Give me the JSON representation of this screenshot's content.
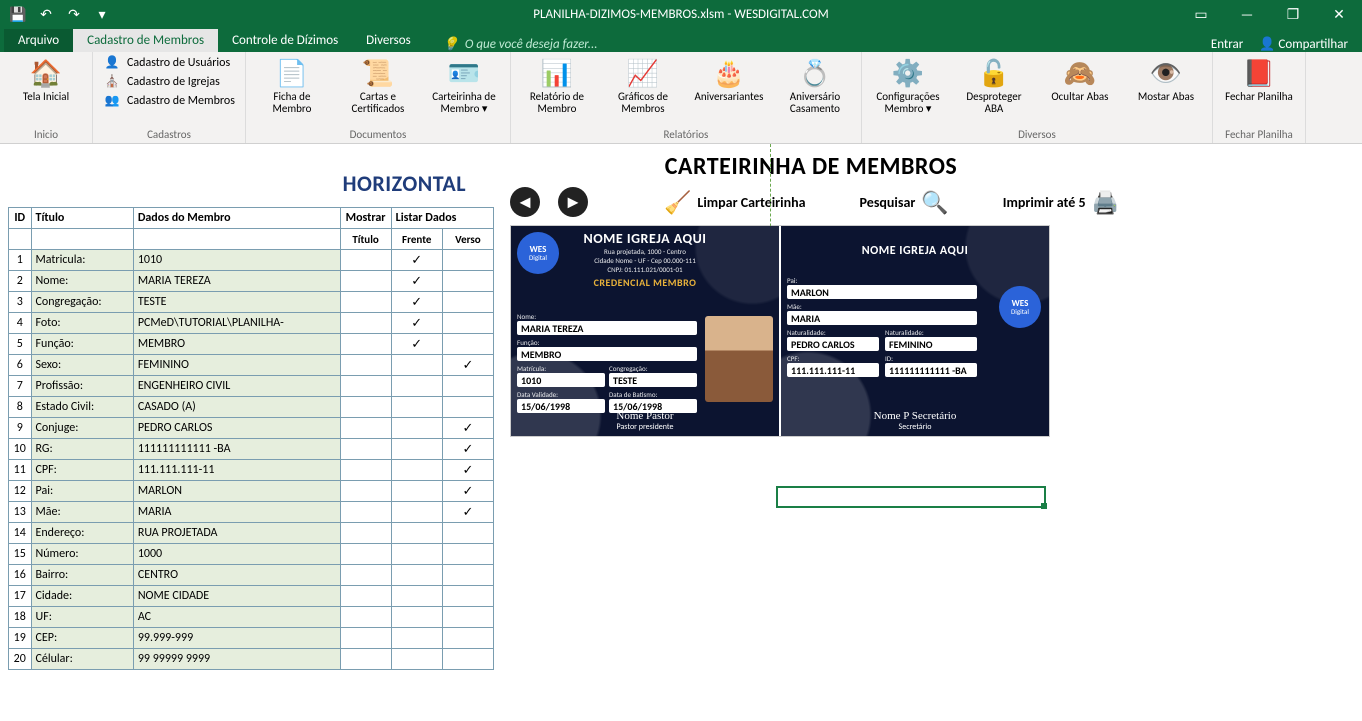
{
  "title": "PLANILHA-DIZIMOS-MEMBROS.xlsm - WESDIGITAL.COM",
  "qat": {
    "save": "💾",
    "undo": "↶",
    "redo": "↷",
    "custom": "▾"
  },
  "win": {
    "opts": "▭",
    "min": "—",
    "max": "❐",
    "close": "✕"
  },
  "tabs": {
    "file": "Arquivo",
    "t1": "Cadastro de Membros",
    "t2": "Controle de Dízimos",
    "t3": "Diversos",
    "tellme": "O que você deseja fazer...",
    "entrar": "Entrar",
    "share": "Compartilhar"
  },
  "ribbon": {
    "g_inicio": {
      "label": "Inicio",
      "b1": "Tela Inicial"
    },
    "g_cadastros": {
      "label": "Cadastros",
      "s1": "Cadastro de Usuários",
      "s2": "Cadastro de Igrejas",
      "s3": "Cadastro de Membros"
    },
    "g_docs": {
      "label": "Documentos",
      "b1": "Ficha de Membro",
      "b2": "Cartas e Certificados",
      "b3": "Carteirinha de Membro ▾"
    },
    "g_rel": {
      "label": "Relatórios",
      "b1": "Relatório de Membro",
      "b2": "Gráficos de Membros",
      "b3": "Aniversariantes",
      "b4": "Aniversário Casamento"
    },
    "g_div": {
      "label": "Diversos",
      "b1": "Configurações Membro ▾",
      "b2": "Desproteger ABA",
      "b3": "Ocultar Abas",
      "b4": "Mostar Abas"
    },
    "g_fechar": {
      "label": "Fechar Planilha",
      "b1": "Fechar Planilha"
    }
  },
  "page": {
    "maintitle": "CARTEIRINHA DE MEMBROS",
    "horiz": "HORIZONTAL",
    "limpar": "Limpar Carteirinha",
    "pesquisar": "Pesquisar",
    "imprimir": "Imprimir até 5"
  },
  "th": {
    "id": "ID",
    "titulo": "Título",
    "dados": "Dados do Membro",
    "mostrar": "Mostrar",
    "listar": "Listar Dados",
    "sub_titulo": "Título",
    "sub_frente": "Frente",
    "sub_verso": "Verso"
  },
  "rows": [
    {
      "id": "1",
      "t": "Matricula:",
      "d": "1010",
      "m": "",
      "f": "✓",
      "v": ""
    },
    {
      "id": "2",
      "t": "Nome:",
      "d": "MARIA TEREZA",
      "m": "",
      "f": "✓",
      "v": ""
    },
    {
      "id": "3",
      "t": "Congregação:",
      "d": "TESTE",
      "m": "",
      "f": "✓",
      "v": ""
    },
    {
      "id": "4",
      "t": "Foto:",
      "d": "PCMeD\\TUTORIAL\\PLANILHA-",
      "m": "",
      "f": "✓",
      "v": ""
    },
    {
      "id": "5",
      "t": "Função:",
      "d": "MEMBRO",
      "m": "",
      "f": "✓",
      "v": ""
    },
    {
      "id": "6",
      "t": "Sexo:",
      "d": "FEMININO",
      "m": "",
      "f": "",
      "v": "✓"
    },
    {
      "id": "7",
      "t": "Profissão:",
      "d": "ENGENHEIRO CIVIL",
      "m": "",
      "f": "",
      "v": ""
    },
    {
      "id": "8",
      "t": "Estado Civil:",
      "d": "CASADO (A)",
      "m": "",
      "f": "",
      "v": ""
    },
    {
      "id": "9",
      "t": "Conjuge:",
      "d": "PEDRO CARLOS",
      "m": "",
      "f": "",
      "v": "✓"
    },
    {
      "id": "10",
      "t": "RG:",
      "d": "111111111111 -BA",
      "m": "",
      "f": "",
      "v": "✓"
    },
    {
      "id": "11",
      "t": "CPF:",
      "d": "111.111.111-11",
      "m": "",
      "f": "",
      "v": "✓"
    },
    {
      "id": "12",
      "t": "Pai:",
      "d": "MARLON",
      "m": "",
      "f": "",
      "v": "✓"
    },
    {
      "id": "13",
      "t": "Mãe:",
      "d": "MARIA",
      "m": "",
      "f": "",
      "v": "✓"
    },
    {
      "id": "14",
      "t": "Endereço:",
      "d": "RUA PROJETADA",
      "m": "",
      "f": "",
      "v": ""
    },
    {
      "id": "15",
      "t": "Número:",
      "d": "1000",
      "m": "",
      "f": "",
      "v": ""
    },
    {
      "id": "16",
      "t": "Bairro:",
      "d": "CENTRO",
      "m": "",
      "f": "",
      "v": ""
    },
    {
      "id": "17",
      "t": "Cidade:",
      "d": "NOME CIDADE",
      "m": "",
      "f": "",
      "v": ""
    },
    {
      "id": "18",
      "t": "UF:",
      "d": "AC",
      "m": "",
      "f": "",
      "v": ""
    },
    {
      "id": "19",
      "t": "CEP:",
      "d": "99.999-999",
      "m": "",
      "f": "",
      "v": ""
    },
    {
      "id": "20",
      "t": "Célular:",
      "d": "99 99999 9999",
      "m": "",
      "f": "",
      "v": ""
    }
  ],
  "card": {
    "church": "NOME IGREJA AQUI",
    "addr1": "Rua projetada, 1000 - Centro",
    "addr2": "Cidade Nome - UF - Cep 00.000-111",
    "cnpj": "CNPJ: 01.111.021/0001-01",
    "cred": "CREDENCIAL MEMBRO",
    "l_nome": "Nome:",
    "v_nome": "MARIA TEREZA",
    "l_func": "Função:",
    "v_func": "MEMBRO",
    "l_mat": "Matrícula:",
    "v_mat": "1010",
    "l_cong": "Congregação:",
    "v_cong": "TESTE",
    "l_val": "Data Validade:",
    "v_val": "15/06/1998",
    "l_bat": "Data de Batismo:",
    "v_bat": "15/06/1998",
    "sig1": "Nome Pastor",
    "sig1role": "Pastor presidente",
    "l_pai": "Pai:",
    "v_pai": "MARLON",
    "l_mae": "Mãe:",
    "v_mae": "MARIA",
    "l_nat": "Naturalidade:",
    "v_nat": "PEDRO CARLOS",
    "l_nat2": "Naturalidade:",
    "v_nat2": "FEMININO",
    "l_cpf": "CPF:",
    "v_cpf": "111.111.111-11",
    "l_id": "ID:",
    "v_id": "111111111111 -BA",
    "sig2": "Nome P Secretário",
    "sig2role": "Secretário",
    "wes": "WES",
    "wesb": "Digital"
  }
}
